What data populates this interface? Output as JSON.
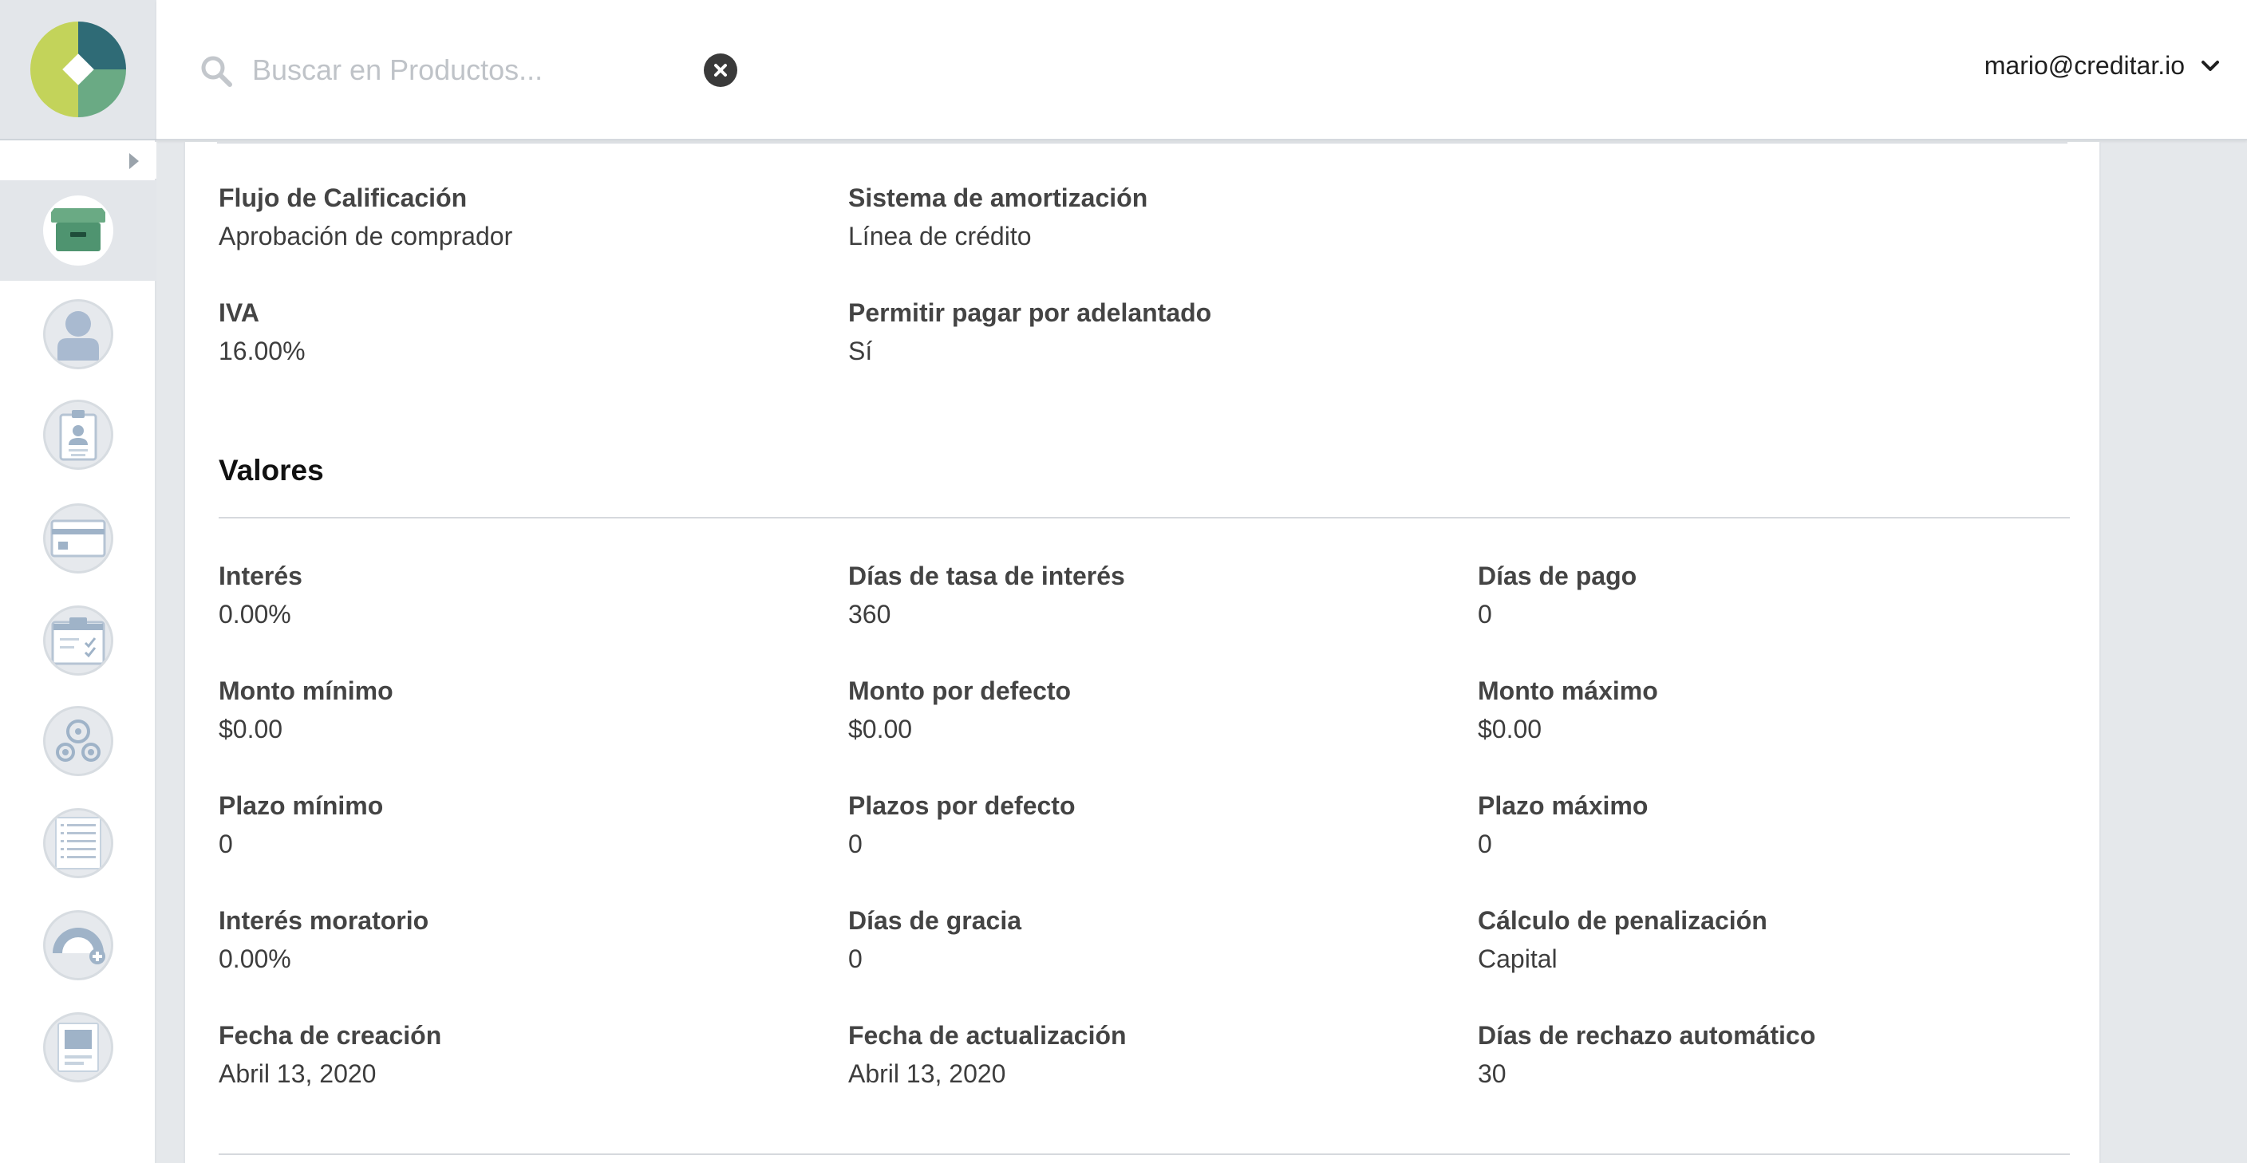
{
  "search": {
    "placeholder": "Buscar en Productos..."
  },
  "user": {
    "email": "mario@creditar.io"
  },
  "nav": [
    {
      "name": "products",
      "active": true
    },
    {
      "name": "users"
    },
    {
      "name": "badge"
    },
    {
      "name": "payments"
    },
    {
      "name": "tasks"
    },
    {
      "name": "webhooks"
    },
    {
      "name": "lists"
    },
    {
      "name": "reports"
    },
    {
      "name": "documents"
    }
  ],
  "general": {
    "flujo_label": "Flujo de Calificación",
    "flujo_value": "Aprobación de comprador",
    "sistema_label": "Sistema de amortización",
    "sistema_value": "Línea de crédito",
    "iva_label": "IVA",
    "iva_value": "16.00%",
    "adelantado_label": "Permitir pagar por adelantado",
    "adelantado_value": "Sí"
  },
  "valores": {
    "title": "Valores",
    "fields": [
      {
        "label": "Interés",
        "value": "0.00%"
      },
      {
        "label": "Días de tasa de interés",
        "value": "360"
      },
      {
        "label": "Días de pago",
        "value": "0"
      },
      {
        "label": "Monto mínimo",
        "value": "$0.00"
      },
      {
        "label": "Monto por defecto",
        "value": "$0.00"
      },
      {
        "label": "Monto máximo",
        "value": "$0.00"
      },
      {
        "label": "Plazo mínimo",
        "value": "0"
      },
      {
        "label": "Plazos por defecto",
        "value": "0"
      },
      {
        "label": "Plazo máximo",
        "value": "0"
      },
      {
        "label": "Interés moratorio",
        "value": "0.00%"
      },
      {
        "label": "Días de gracia",
        "value": "0"
      },
      {
        "label": "Cálculo de penalización",
        "value": "Capital"
      },
      {
        "label": "Fecha de creación",
        "value": "Abril 13, 2020"
      },
      {
        "label": "Fecha de actualización",
        "value": "Abril 13, 2020"
      },
      {
        "label": "Días de rechazo automático",
        "value": "30"
      }
    ]
  },
  "colors": {
    "brand_green": "#c3d35a",
    "brand_teal": "#2f6b76",
    "brand_mid": "#6aaa84",
    "nav_icon": "#9fb3c8",
    "active_icon": "#5a9c78"
  }
}
